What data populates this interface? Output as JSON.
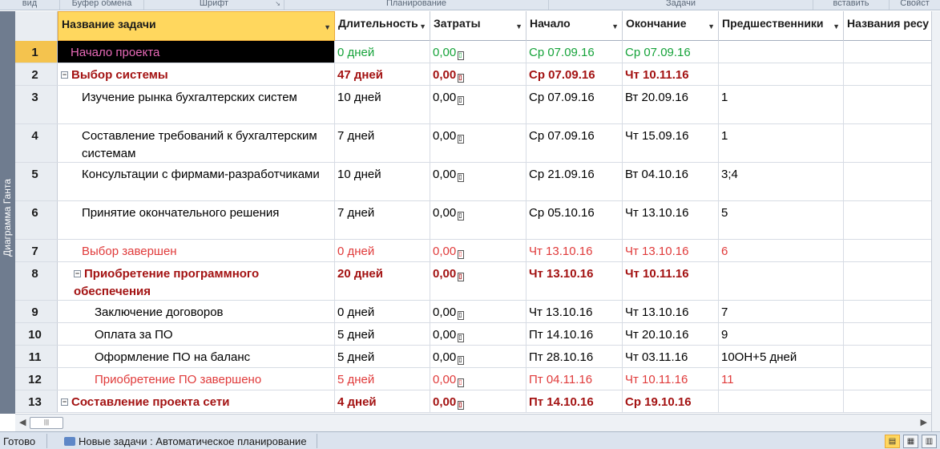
{
  "ribbon": {
    "groups": [
      "вид",
      "Буфер обмена",
      "Шрифт",
      "Планирование",
      "Задачи",
      "вставить",
      "Свойст"
    ]
  },
  "side_tab": {
    "label": "Диаграмма Ганта"
  },
  "columns": {
    "name": "Название задачи",
    "duration": "Длительность",
    "cost": "Затраты",
    "start": "Начало",
    "finish": "Окончание",
    "predecessors": "Предшественники",
    "resources": "Названия ресу"
  },
  "cost_icon": "▯",
  "rows": [
    {
      "id": "1",
      "name": "Начало проекта",
      "duration": "0 дней",
      "cost": "0,00",
      "start": "Ср 07.09.16",
      "finish": "Ср 07.09.16",
      "pred": "",
      "style": "green"
    },
    {
      "id": "2",
      "name": "Выбор системы",
      "duration": "47 дней",
      "cost": "0,00",
      "start": "Ср 07.09.16",
      "finish": "Чт 10.11.16",
      "pred": "",
      "style": "sum"
    },
    {
      "id": "3",
      "name": "Изучение рынка бухгалтерских систем",
      "duration": "10 дней",
      "cost": "0,00",
      "start": "Ср 07.09.16",
      "finish": "Вт 20.09.16",
      "pred": "1",
      "style": "task"
    },
    {
      "id": "4",
      "name": "Составление требований к бухгалтерским системам",
      "duration": "7 дней",
      "cost": "0,00",
      "start": "Ср 07.09.16",
      "finish": "Чт 15.09.16",
      "pred": "1",
      "style": "task"
    },
    {
      "id": "5",
      "name": "Консультации с фирмами-разработчиками",
      "duration": "10 дней",
      "cost": "0,00",
      "start": "Ср 21.09.16",
      "finish": "Вт 04.10.16",
      "pred": "3;4",
      "style": "task"
    },
    {
      "id": "6",
      "name": "Принятие окончательного решения",
      "duration": "7 дней",
      "cost": "0,00",
      "start": "Ср 05.10.16",
      "finish": "Чт 13.10.16",
      "pred": "5",
      "style": "task"
    },
    {
      "id": "7",
      "name": "Выбор завершен",
      "duration": "0 дней",
      "cost": "0,00",
      "start": "Чт 13.10.16",
      "finish": "Чт 13.10.16",
      "pred": "6",
      "style": "ms"
    },
    {
      "id": "8",
      "name": "Приобретение программного обеспечения",
      "duration": "20 дней",
      "cost": "0,00",
      "start": "Чт 13.10.16",
      "finish": "Чт 10.11.16",
      "pred": "",
      "style": "sum"
    },
    {
      "id": "9",
      "name": "Заключение договоров",
      "duration": "0 дней",
      "cost": "0,00",
      "start": "Чт 13.10.16",
      "finish": "Чт 13.10.16",
      "pred": "7",
      "style": "task"
    },
    {
      "id": "10",
      "name": "Оплата за ПО",
      "duration": "5 дней",
      "cost": "0,00",
      "start": "Пт 14.10.16",
      "finish": "Чт 20.10.16",
      "pred": "9",
      "style": "task"
    },
    {
      "id": "11",
      "name": "Оформление ПО на баланс",
      "duration": "5 дней",
      "cost": "0,00",
      "start": "Пт 28.10.16",
      "finish": "Чт 03.11.16",
      "pred": "10ОН+5 дней",
      "style": "task"
    },
    {
      "id": "12",
      "name": "Приобретение ПО завершено",
      "duration": "5 дней",
      "cost": "0,00",
      "start": "Пт 04.11.16",
      "finish": "Чт 10.11.16",
      "pred": "11",
      "style": "ms"
    },
    {
      "id": "13",
      "name": "Составление проекта сети",
      "duration": "4 дней",
      "cost": "0,00",
      "start": "Пт 14.10.16",
      "finish": "Ср 19.10.16",
      "pred": "",
      "style": "sum"
    }
  ],
  "status": {
    "ready": "Готово",
    "mode": "Новые задачи : Автоматическое планирование"
  }
}
